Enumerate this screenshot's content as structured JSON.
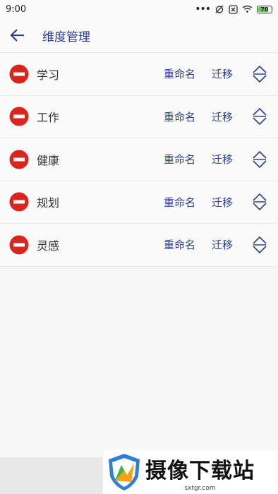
{
  "status_bar": {
    "time": "9:00",
    "dots": "•••",
    "battery": "70"
  },
  "app_bar": {
    "title": "维度管理"
  },
  "rows": [
    {
      "label": "学习",
      "rename": "重命名",
      "move": "迁移"
    },
    {
      "label": "工作",
      "rename": "重命名",
      "move": "迁移"
    },
    {
      "label": "健康",
      "rename": "重命名",
      "move": "迁移"
    },
    {
      "label": "规划",
      "rename": "重命名",
      "move": "迁移"
    },
    {
      "label": "灵感",
      "rename": "重命名",
      "move": "迁移"
    }
  ],
  "watermark": {
    "title": "摄像下载站",
    "url": "sxtgr.com"
  },
  "colors": {
    "accent": "#2c3e8c",
    "delete": "#d9261c",
    "background": "#f7f7f7"
  }
}
